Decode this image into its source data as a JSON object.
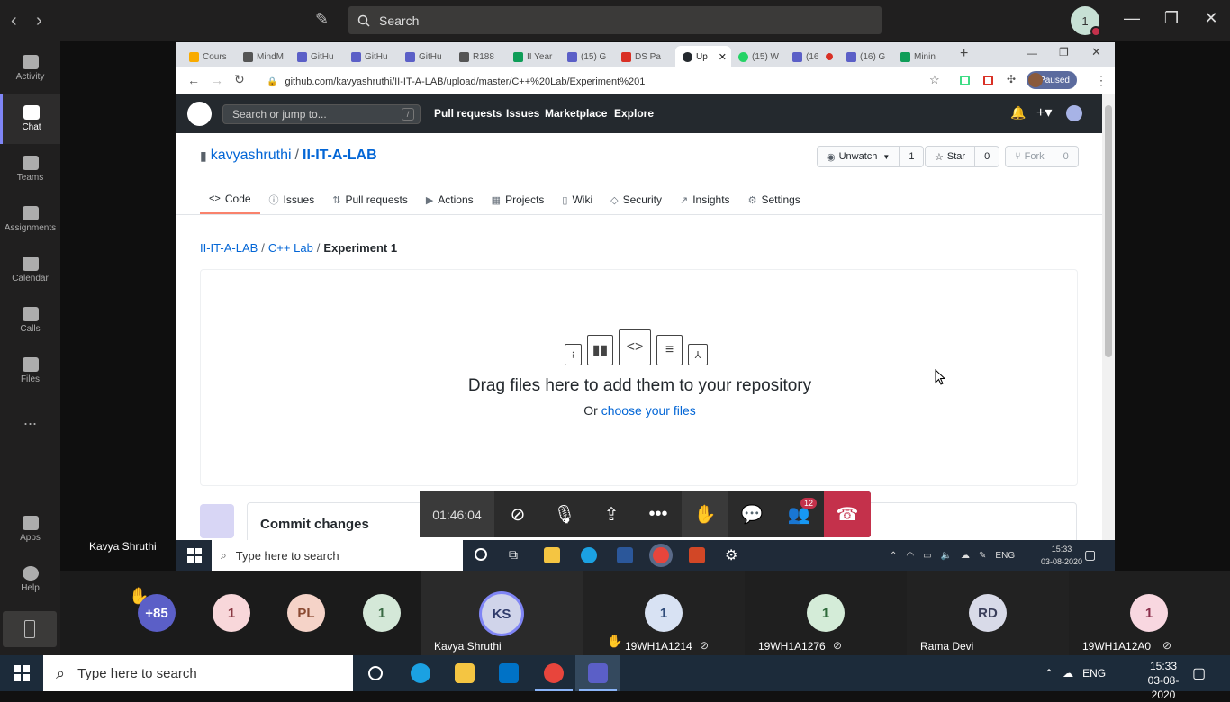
{
  "teams": {
    "search_placeholder": "Search",
    "avatar_initial": "1",
    "rail": [
      {
        "label": "Activity"
      },
      {
        "label": "Chat"
      },
      {
        "label": "Teams"
      },
      {
        "label": "Assignments"
      },
      {
        "label": "Calendar"
      },
      {
        "label": "Calls"
      },
      {
        "label": "Files"
      },
      {
        "label": "Apps"
      },
      {
        "label": "Help"
      }
    ],
    "more_label": "..."
  },
  "stage": {
    "presenter_name": "Kavya Shruthi"
  },
  "browser": {
    "tabs": [
      {
        "label": "Cours",
        "color": "#f9ab00"
      },
      {
        "label": "MindM",
        "color": "#555555"
      },
      {
        "label": "GitHu",
        "color": "#5b5fc7"
      },
      {
        "label": "GitHu",
        "color": "#5b5fc7"
      },
      {
        "label": "GitHu",
        "color": "#5b5fc7"
      },
      {
        "label": "R188",
        "color": "#555555"
      },
      {
        "label": "II Year",
        "color": "#0f9d58"
      },
      {
        "label": "(15) G",
        "color": "#5b5fc7"
      },
      {
        "label": "DS Pa",
        "color": "#d93025"
      },
      {
        "label": "Up",
        "color": "#24292e"
      },
      {
        "label": "(15) W",
        "color": "#25d366"
      },
      {
        "label": "(16",
        "color": "#5b5fc7"
      },
      {
        "label": "(16) G",
        "color": "#5b5fc7"
      },
      {
        "label": "Minin",
        "color": "#0f9d58"
      }
    ],
    "url": "github.com/kavyashruthi/II-IT-A-LAB/upload/master/C++%20Lab/Experiment%201",
    "profile_status": "Paused"
  },
  "github": {
    "search_placeholder": "Search or jump to...",
    "search_shortcut": "/",
    "nav": [
      "Pull requests",
      "Issues",
      "Marketplace",
      "Explore"
    ],
    "owner": "kavyashruthi",
    "separator": "/",
    "repo": "II-IT-A-LAB",
    "unwatch_label": "Unwatch",
    "unwatch_count": "1",
    "star_label": "Star",
    "star_count": "0",
    "fork_label": "Fork",
    "fork_count": "0",
    "tabs": [
      {
        "label": "Code",
        "icon": "<>"
      },
      {
        "label": "Issues",
        "icon": "ⓘ"
      },
      {
        "label": "Pull requests",
        "icon": "⇅"
      },
      {
        "label": "Actions",
        "icon": "▶"
      },
      {
        "label": "Projects",
        "icon": "▦"
      },
      {
        "label": "Wiki",
        "icon": "▯"
      },
      {
        "label": "Security",
        "icon": "◇"
      },
      {
        "label": "Insights",
        "icon": "↗"
      },
      {
        "label": "Settings",
        "icon": "⚙"
      }
    ],
    "breadcrumb": {
      "root": "II-IT-A-LAB",
      "sep1": "/",
      "folder": "C++ Lab",
      "sep2": "/",
      "current": "Experiment 1"
    },
    "drop_title": "Drag files here to add them to your repository",
    "drop_or": "Or",
    "choose_files": "choose your files",
    "commit_title": "Commit changes"
  },
  "meeting": {
    "timer": "01:46:04",
    "badge_count": "12"
  },
  "inner_taskbar": {
    "search_placeholder": "Type here to search",
    "lang": "ENG",
    "time": "15:33",
    "date": "03-08-2020"
  },
  "participants": [
    {
      "initials": "+85",
      "name": "",
      "color": "#5b5fc7",
      "text_color": "#ffffff"
    },
    {
      "initials": "1",
      "name": "",
      "color": "#f8d7da",
      "text_color": "#8a3a44"
    },
    {
      "initials": "PL",
      "name": "",
      "color": "#f5d3c8",
      "text_color": "#8a4a32"
    },
    {
      "initials": "1",
      "name": "",
      "color": "#d4e8d8",
      "text_color": "#3a6a44"
    },
    {
      "initials": "KS",
      "name": "Kavya Shruthi",
      "color": "#d0d4ea",
      "text_color": "#2e3a6a"
    },
    {
      "initials": "1",
      "name": "19WH1A1214",
      "color": "#d8e2f3",
      "text_color": "#2e4a78"
    },
    {
      "initials": "1",
      "name": "19WH1A1276",
      "color": "#d4ecd8",
      "text_color": "#2e6a3a"
    },
    {
      "initials": "RD",
      "name": "Rama Devi",
      "color": "#d8dae8",
      "text_color": "#3a3e5a"
    },
    {
      "initials": "1",
      "name": "19WH1A12A0",
      "color": "#f8d7e0",
      "text_color": "#8a2e4a"
    }
  ],
  "taskbar": {
    "search_placeholder": "Type here to search",
    "lang": "ENG",
    "time": "15:33",
    "date": "03-08-2020"
  }
}
